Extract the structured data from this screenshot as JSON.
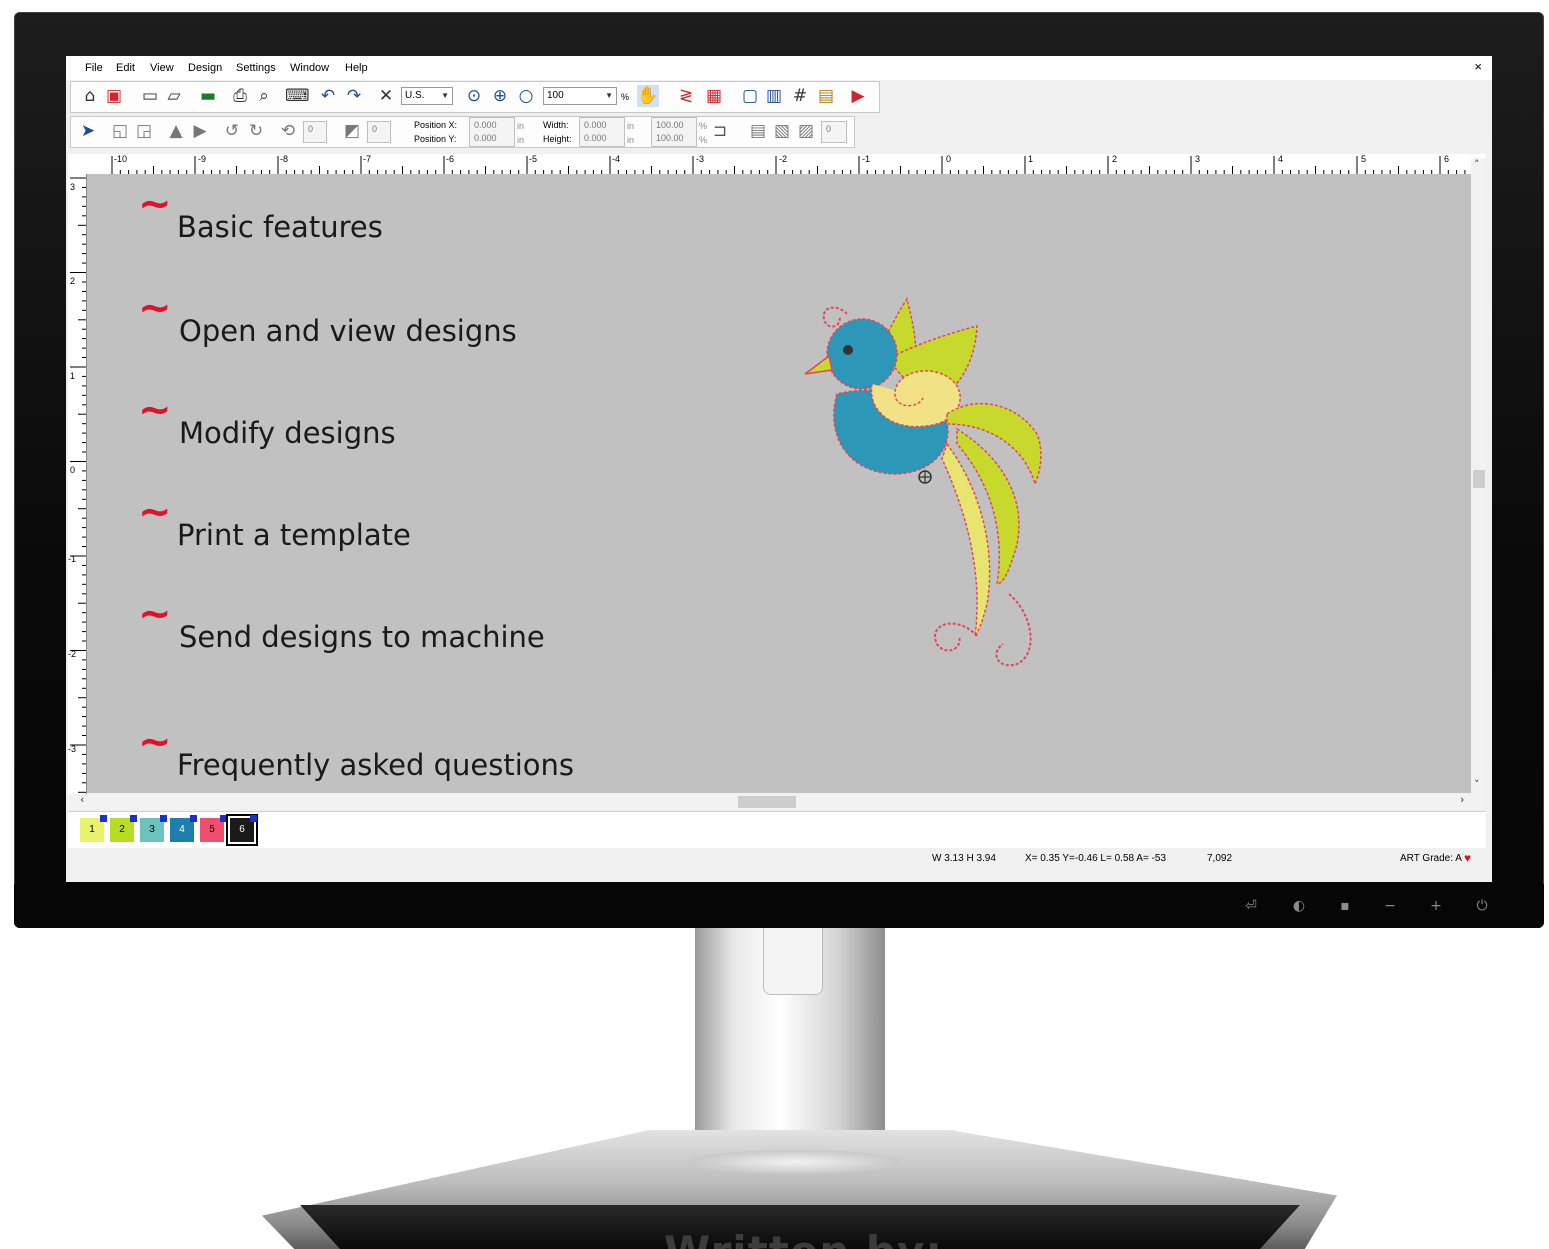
{
  "app": {
    "menu": [
      "File",
      "Edit",
      "View",
      "Design",
      "Settings",
      "Window",
      "Help"
    ],
    "close_glyph": "×"
  },
  "toolbar1": {
    "units": "U.S.",
    "zoom_value": "100",
    "zoom_suffix": "%"
  },
  "toolbar2": {
    "rotate_value": "0",
    "slant_value": "0",
    "position_x_label": "Position X:",
    "position_x_value": "0.000",
    "position_y_label": "Position Y:",
    "position_y_value": "0.000",
    "unit": "in",
    "width_label": "Width:",
    "width_value": "0.000",
    "height_label": "Height:",
    "height_value": "0.000",
    "scale_w": "100.00",
    "scale_h": "100.00",
    "percent": "%",
    "stitch_value": "0"
  },
  "rulers": {
    "horizontal": [
      "-10",
      "-9",
      "-8",
      "-7",
      "-6",
      "-5",
      "-4",
      "-3",
      "-2",
      "-1",
      "0",
      "1",
      "2",
      "3",
      "4",
      "5",
      "6"
    ],
    "vertical": [
      "3",
      "2",
      "1",
      "0",
      "-1",
      "-2",
      "-3"
    ]
  },
  "features": {
    "tilde": "~",
    "items": [
      "Basic features",
      "Open and view designs",
      "Modify designs",
      "Print a template",
      "Send designs to machine",
      "Frequently asked questions"
    ]
  },
  "colors": {
    "swatches": [
      {
        "label": "1",
        "color": "#e9f26c"
      },
      {
        "label": "2",
        "color": "#b6dd22"
      },
      {
        "label": "3",
        "color": "#6cc3bd"
      },
      {
        "label": "4",
        "color": "#1e7eae"
      },
      {
        "label": "5",
        "color": "#ef4f6e"
      },
      {
        "label": "6",
        "color": "#1a1a1a"
      }
    ]
  },
  "status": {
    "size": "W 3.13 H 3.94",
    "coords": "X= 0.35 Y=-0.46 L= 0.58 A= -53",
    "stitches": "7,092",
    "grade": "ART Grade: A"
  },
  "caption": "Written by:"
}
